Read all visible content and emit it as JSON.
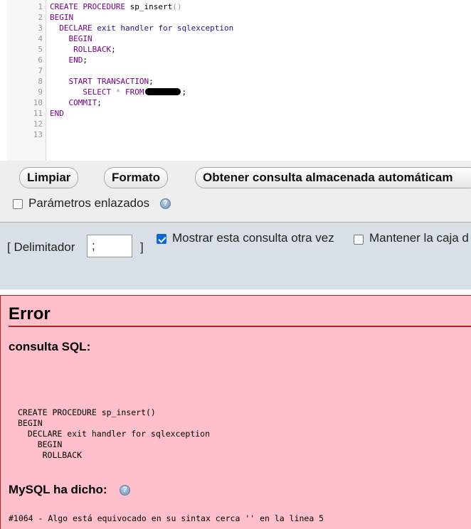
{
  "editor": {
    "line_numbers": [
      "1",
      "2",
      "3",
      "4",
      "5",
      "6",
      "7",
      "8",
      "9",
      "10",
      "11",
      "12",
      "13"
    ],
    "lines": [
      {
        "kw": "CREATE PROCEDURE",
        "pl": " sp_insert",
        "op": "()"
      },
      {
        "kw": "BEGIN"
      },
      {
        "indent": "  ",
        "kw": "DECLARE",
        "id": " exit handler for sqlexception"
      },
      {
        "indent": "    ",
        "kw": "BEGIN"
      },
      {
        "indent": "     ",
        "kw": "ROLLBACK",
        "pl": ";"
      },
      {
        "indent": "    ",
        "kw": "END",
        "pl": ";"
      },
      {},
      {
        "indent": "    ",
        "kw": "START TRANSACTION",
        "pl": ";"
      },
      {
        "indent": "       ",
        "kw": "SELECT",
        "op": " * ",
        "kw2": "FROM",
        "pl": ";"
      },
      {
        "indent": "    ",
        "kw": "COMMIT",
        "pl": ";"
      },
      {
        "kw": "END"
      },
      {},
      {}
    ]
  },
  "toolbar": {
    "clear_label": "Limpiar",
    "format_label": "Formato",
    "get_auto_query_label": "Obtener consulta almacenada automáticam",
    "bind_params_label": "Parámetros enlazados",
    "help_glyph": "?"
  },
  "options": {
    "delimiter_open": "[ Delimitador",
    "delimiter_value": ";",
    "delimiter_close": "]",
    "show_query_again_label": "Mostrar esta consulta otra vez",
    "show_query_again_checked": true,
    "keep_box_label": "Mantener la caja d",
    "keep_box_checked": false
  },
  "error": {
    "title": "Error",
    "sql_heading": "consulta SQL:",
    "sql_lines": [
      "CREATE PROCEDURE sp_insert()",
      "BEGIN",
      "  DECLARE exit handler for sqlexception",
      "    BEGIN",
      "     ROLLBACK"
    ],
    "mysql_heading": "MySQL ha dicho:",
    "mysql_message": "#1064 - Algo está equivocado en su sintax cerca '' en la linea 5"
  },
  "colors": {
    "keyword": "#770088",
    "identifier": "#221199",
    "error_background": "#ffc0cb",
    "error_rule": "#bb2222",
    "checkbox_checked": "#0a68d6"
  }
}
